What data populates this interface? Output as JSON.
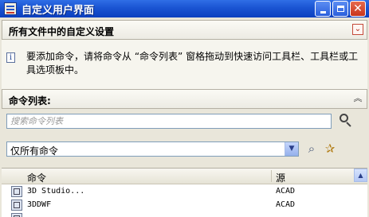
{
  "window": {
    "title": "自定义用户界面"
  },
  "sections": {
    "all_files": {
      "label": "所有文件中的自定义设置",
      "toggle": "collapse"
    },
    "command_list": {
      "label": "命令列表:",
      "toggle": "expand"
    }
  },
  "info": {
    "text": "要添加命令，请将命令从 “命令列表” 窗格拖动到快速访问工具栏、工具栏或工具选项板中。"
  },
  "search": {
    "placeholder": "搜索命令列表",
    "value": ""
  },
  "filter": {
    "selected": "仅所有命令"
  },
  "table": {
    "columns": {
      "command": "命令",
      "source": "源"
    },
    "rows": [
      {
        "name": "3D Studio...",
        "source": "ACAD",
        "icon": "import-icon"
      },
      {
        "name": "3DDWF",
        "source": "ACAD",
        "icon": "dwf-icon"
      },
      {
        "name": "",
        "source": "",
        "icon": "command-icon"
      }
    ]
  },
  "colors": {
    "titlebar": "#0b3fbf",
    "close_button": "#c8351c",
    "accent_border": "#7f9db9"
  }
}
